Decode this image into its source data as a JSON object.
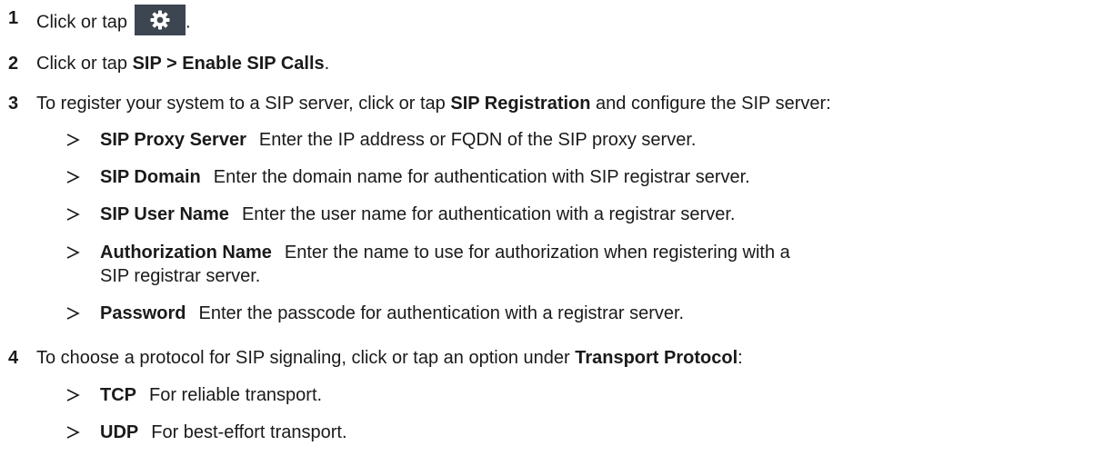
{
  "steps": [
    {
      "number": "1",
      "pre": "Click or tap",
      "icon": "gear-icon",
      "post": "."
    },
    {
      "number": "2",
      "pre": "Click or tap ",
      "bold": "SIP > Enable SIP Calls",
      "post": "."
    },
    {
      "number": "3",
      "pre": "To register your system to a SIP server, click or tap ",
      "bold": "SIP Registration",
      "post": " and configure the SIP server:",
      "items": [
        {
          "term": "SIP Proxy Server",
          "desc": "Enter the IP address or FQDN of the SIP proxy server."
        },
        {
          "term": "SIP Domain",
          "desc": "Enter the domain name for authentication with SIP registrar server."
        },
        {
          "term": "SIP User Name",
          "desc": "Enter the user name for authentication with a registrar server."
        },
        {
          "term": "Authorization Name",
          "desc": "Enter the name to use for authorization when registering with a SIP registrar server."
        },
        {
          "term": "Password",
          "desc": "Enter the passcode for authentication with a registrar server."
        }
      ]
    },
    {
      "number": "4",
      "pre": "To choose a protocol for SIP signaling, click or tap an option under ",
      "bold": "Transport Protocol",
      "post": ":",
      "items": [
        {
          "term": "TCP",
          "desc": "For reliable transport."
        },
        {
          "term": "UDP",
          "desc": "For best-effort transport."
        }
      ]
    }
  ],
  "colors": {
    "text": "#1a1a1a",
    "button_bg": "#3d4550",
    "icon": "#ffffff"
  }
}
